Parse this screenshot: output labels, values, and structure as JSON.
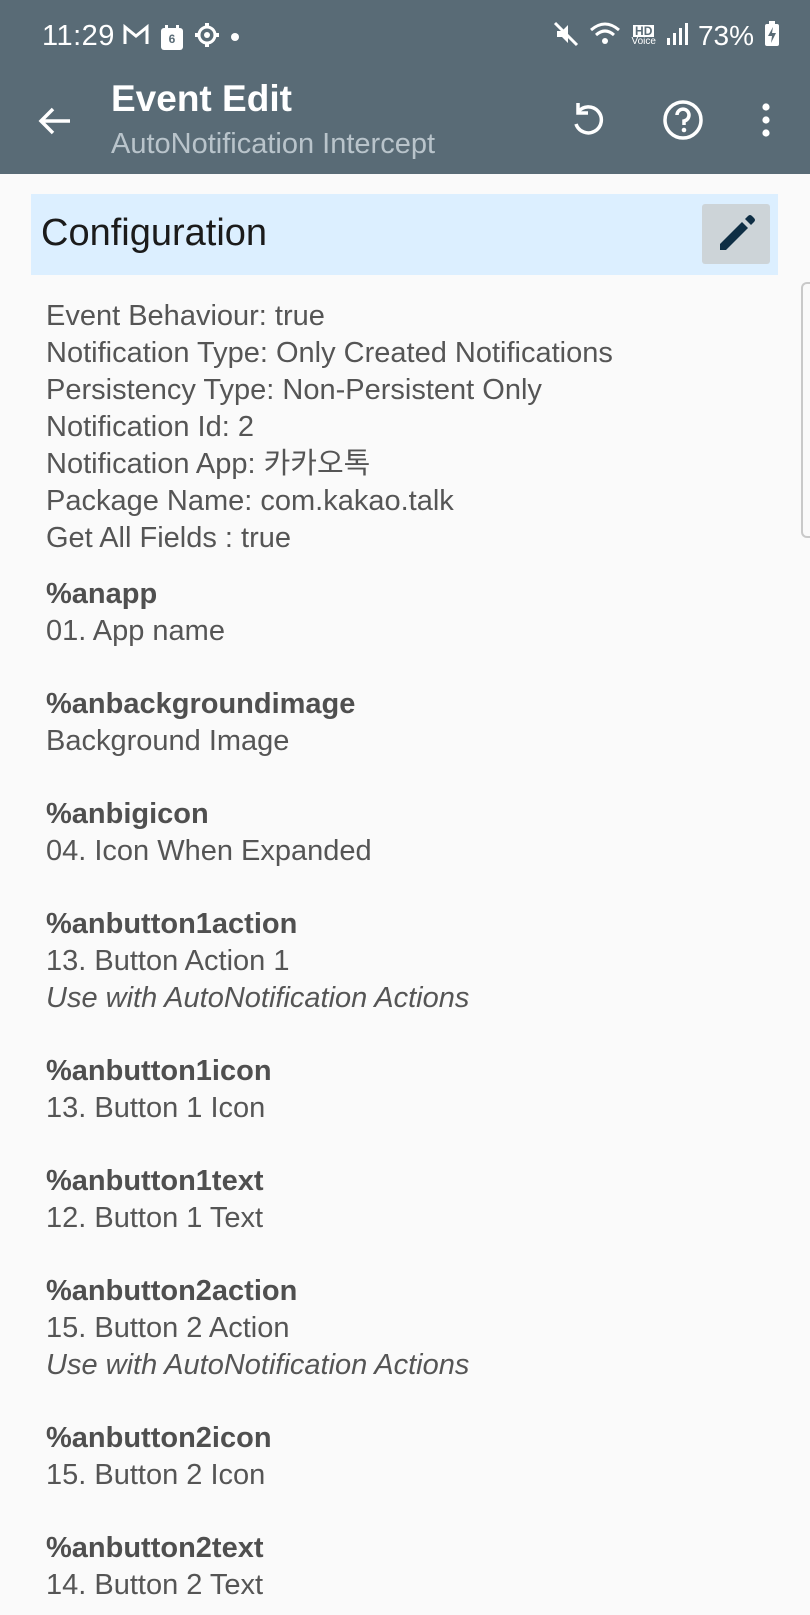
{
  "status": {
    "time": "11:29",
    "battery": "73%",
    "calendar_badge": "6",
    "hd_voice_top": "HD",
    "hd_voice_bottom": "Voice"
  },
  "appbar": {
    "title": "Event Edit",
    "subtitle": "AutoNotification Intercept"
  },
  "config": {
    "title": "Configuration",
    "lines": [
      "Event Behaviour: true",
      "Notification Type: Only Created Notifications",
      "Persistency Type: Non-Persistent Only",
      "Notification Id: 2",
      "Notification App: 카카오톡",
      "Package Name: com.kakao.talk",
      "Get All Fields : true"
    ]
  },
  "variables": [
    {
      "name": "%anapp",
      "desc": "01. App name",
      "note": ""
    },
    {
      "name": "%anbackgroundimage",
      "desc": "Background Image",
      "note": ""
    },
    {
      "name": "%anbigicon",
      "desc": "04. Icon When Expanded",
      "note": ""
    },
    {
      "name": "%anbutton1action",
      "desc": "13. Button Action 1",
      "note": "Use with AutoNotification Actions"
    },
    {
      "name": "%anbutton1icon",
      "desc": "13. Button 1 Icon",
      "note": ""
    },
    {
      "name": "%anbutton1text",
      "desc": "12. Button 1 Text",
      "note": ""
    },
    {
      "name": "%anbutton2action",
      "desc": "15. Button 2 Action",
      "note": "Use with AutoNotification Actions"
    },
    {
      "name": "%anbutton2icon",
      "desc": "15. Button 2 Icon",
      "note": ""
    },
    {
      "name": "%anbutton2text",
      "desc": "14. Button 2 Text",
      "note": ""
    }
  ],
  "colors": {
    "appbar": "#596b76",
    "header_bg": "#dcefff",
    "background": "#fafafa"
  }
}
